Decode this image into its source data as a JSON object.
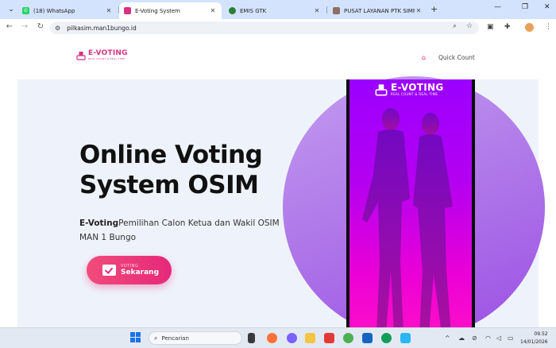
{
  "browser": {
    "tabs": [
      {
        "label": "(18) WhatsApp",
        "fav_color": "#25d366",
        "active": false
      },
      {
        "label": "E-Voting System",
        "fav_color": "#d63384",
        "active": true
      },
      {
        "label": "EMIS GTK",
        "fav_color": "#2e7d32",
        "active": false
      },
      {
        "label": "PUSAT LAYANAN PTK SIMPATIK",
        "fav_color": "#8d6e63",
        "active": false
      }
    ],
    "url": "pilkasim.man1bungo.id"
  },
  "site": {
    "logo": {
      "title": "E-VOTING",
      "subtitle": "REAL COUNT & REAL TIME"
    },
    "nav": {
      "quick_count": "Quick Count"
    },
    "hero": {
      "title": "Online Voting System OSIM",
      "desc_bold": "E-Voting",
      "desc_rest": "Pemilihan Calon Ketua dan Wakil OSIM MAN 1 Bungo",
      "cta_small": "VOTING",
      "cta_big": "Sekarang"
    },
    "phone_logo": {
      "title": "E-VOTING",
      "subtitle": "REAL COUNT & REAL TIME"
    }
  },
  "taskbar": {
    "search_placeholder": "Pencarian",
    "time": "09.52",
    "date": "14/01/2026"
  },
  "colors": {
    "brand": "#d63384",
    "cta": "#e6287a"
  }
}
